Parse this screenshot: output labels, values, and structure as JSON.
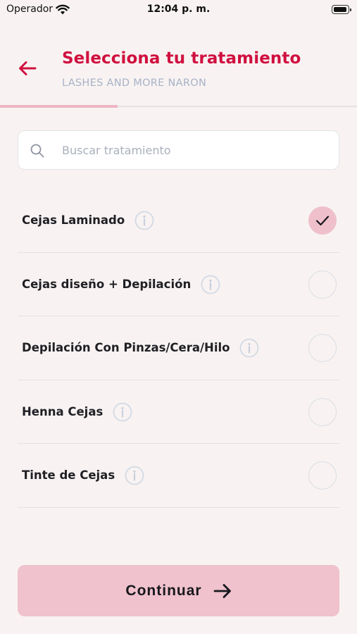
{
  "status_bar": {
    "carrier": "Operador",
    "time": "12:04 p. m."
  },
  "header": {
    "title": "Selecciona tu tratamiento",
    "subtitle": "LASHES AND MORE NARON",
    "progress": 0.33
  },
  "search": {
    "placeholder": "Buscar tratamiento",
    "value": ""
  },
  "treatments": [
    {
      "label": "Cejas Laminado",
      "selected": true
    },
    {
      "label": "Cejas diseño + Depilación",
      "selected": false
    },
    {
      "label": "Depilación Con Pinzas/Cera/Hilo",
      "selected": false
    },
    {
      "label": "Henna Cejas",
      "selected": false
    },
    {
      "label": "Tinte de Cejas",
      "selected": false
    }
  ],
  "continue_button": {
    "label": "Continuar"
  },
  "colors": {
    "accent": "#d0103f",
    "selected_fill": "#efc0cc",
    "button_bg": "#efc2cd",
    "background": "#f8f3f2"
  }
}
